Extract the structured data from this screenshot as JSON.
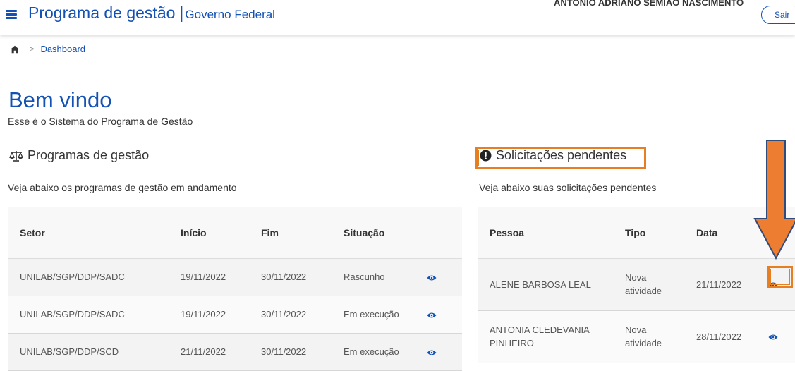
{
  "header": {
    "app_title": "Programa de gestão",
    "separator": "|",
    "org_name": "Governo Federal",
    "user_name": "ANTONIO ADRIANO SEMIAO NASCIMENTO",
    "logout_label": "Sair"
  },
  "breadcrumb": {
    "items": [
      "Dashboard"
    ]
  },
  "page": {
    "title": "Bem vindo",
    "subtitle": "Esse é o Sistema do Programa de Gestão"
  },
  "programs": {
    "title": "Programas de gestão",
    "description": "Veja abaixo os programas de gestão em andamento",
    "columns": [
      "Setor",
      "Início",
      "Fim",
      "Situação"
    ],
    "rows": [
      {
        "setor": "UNILAB/SGP/DDP/SADC",
        "inicio": "19/11/2022",
        "fim": "30/11/2022",
        "situacao": "Rascunho"
      },
      {
        "setor": "UNILAB/SGP/DDP/SADC",
        "inicio": "19/11/2022",
        "fim": "30/11/2022",
        "situacao": "Em execução"
      },
      {
        "setor": "UNILAB/SGP/DDP/SCD",
        "inicio": "21/11/2022",
        "fim": "30/11/2022",
        "situacao": "Em execução"
      }
    ]
  },
  "pending": {
    "title": "Solicitações pendentes",
    "description": "Veja abaixo suas solicitações pendentes",
    "columns": [
      "Pessoa",
      "Tipo",
      "Data"
    ],
    "rows": [
      {
        "pessoa_line1": "ALENE BARBOSA LEAL",
        "pessoa_line2": "",
        "tipo_line1": "Nova",
        "tipo_line2": "atividade",
        "data": "21/11/2022"
      },
      {
        "pessoa_line1": "ANTONIA CLEDEVANIA",
        "pessoa_line2": "PINHEIRO",
        "tipo_line1": "Nova",
        "tipo_line2": "atividade",
        "data": "28/11/2022"
      }
    ]
  },
  "colors": {
    "primary": "#1351b4",
    "annotation": "#e67e22"
  },
  "icons": {
    "menu": "hamburger-icon",
    "home": "home-icon",
    "programs": "balance-scale-icon",
    "pending": "exclamation-circle-icon",
    "view": "eye-icon"
  }
}
